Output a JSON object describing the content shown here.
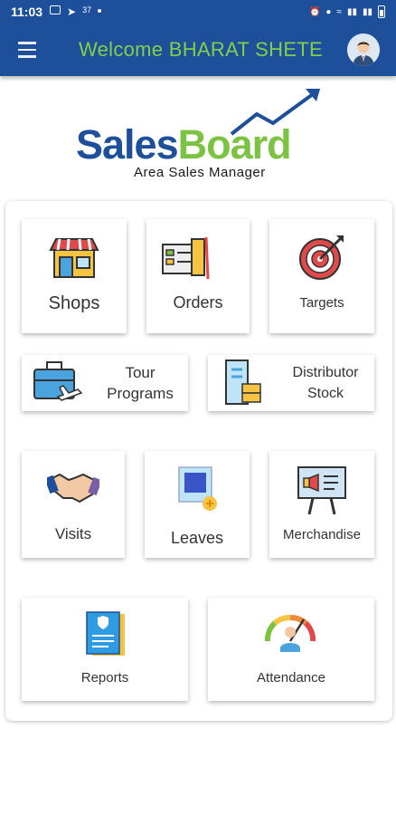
{
  "status_bar": {
    "time": "11:03",
    "signal_small_text": "37"
  },
  "app_bar": {
    "title": "Welcome BHARAT SHETE"
  },
  "logo": {
    "sales": "Sales",
    "board": "Board",
    "subtitle": "Area Sales Manager"
  },
  "tiles": {
    "shops": "Shops",
    "orders": "Orders",
    "targets": "Targets",
    "tour_programs": [
      "Tour",
      "Programs"
    ],
    "distributor_stock": [
      "Distributor",
      "Stock"
    ],
    "visits": "Visits",
    "leaves": "Leaves",
    "merchandise": "Merchandise",
    "reports": "Reports",
    "attendance": "Attendance"
  },
  "colors": {
    "brand_blue": "#1d4f9b",
    "brand_green": "#7cc243",
    "title_green": "#7fd14b"
  }
}
